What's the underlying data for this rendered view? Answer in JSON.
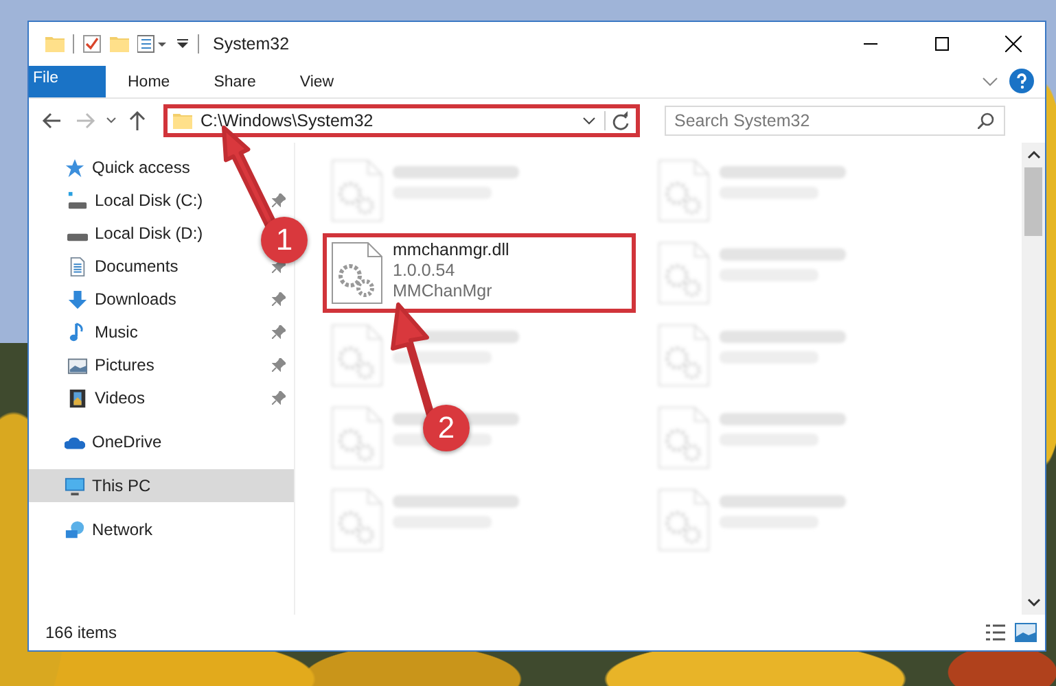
{
  "window": {
    "title": "System32"
  },
  "ribbon_tabs": [
    {
      "label": "File",
      "kind": "file",
      "selected": false
    },
    {
      "label": "Home",
      "kind": "tab",
      "selected": false
    },
    {
      "label": "Share",
      "kind": "tab",
      "selected": false
    },
    {
      "label": "View",
      "kind": "tab",
      "selected": false
    }
  ],
  "address": {
    "value": "C:\\Windows\\System32",
    "highlighted": true
  },
  "search": {
    "placeholder": "Search System32"
  },
  "sidebar": {
    "items": [
      {
        "label": "Quick access",
        "kind": "star",
        "selected": false,
        "children": [
          {
            "label": "Local Disk (C:)",
            "kind": "drive-c",
            "pinned": true
          },
          {
            "label": "Local Disk (D:)",
            "kind": "drive"
          },
          {
            "label": "Documents",
            "kind": "documents",
            "pinned": true
          },
          {
            "label": "Downloads",
            "kind": "downloads",
            "pinned": true
          },
          {
            "label": "Music",
            "kind": "music",
            "pinned": true
          },
          {
            "label": "Pictures",
            "kind": "pictures",
            "pinned": true
          },
          {
            "label": "Videos",
            "kind": "videos",
            "pinned": true
          }
        ]
      },
      {
        "label": "OneDrive",
        "kind": "cloud",
        "selected": false
      },
      {
        "label": "This PC",
        "kind": "pc",
        "selected": true
      },
      {
        "label": "Network",
        "kind": "network",
        "selected": false
      }
    ]
  },
  "files": [
    {
      "kind": "blurred"
    },
    {
      "kind": "blurred"
    },
    {
      "kind": "file",
      "name": "mmchanmgr.dll",
      "lines": [
        "1.0.0.54",
        "MMChanMgr"
      ],
      "highlighted": true
    },
    {
      "kind": "blurred"
    },
    {
      "kind": "blurred"
    },
    {
      "kind": "blurred"
    },
    {
      "kind": "blurred"
    },
    {
      "kind": "blurred"
    },
    {
      "kind": "blurred"
    },
    {
      "kind": "blurred"
    }
  ],
  "status_bar": {
    "text": "166 items"
  },
  "annotations": [
    {
      "number": "1"
    },
    {
      "number": "2"
    }
  ]
}
